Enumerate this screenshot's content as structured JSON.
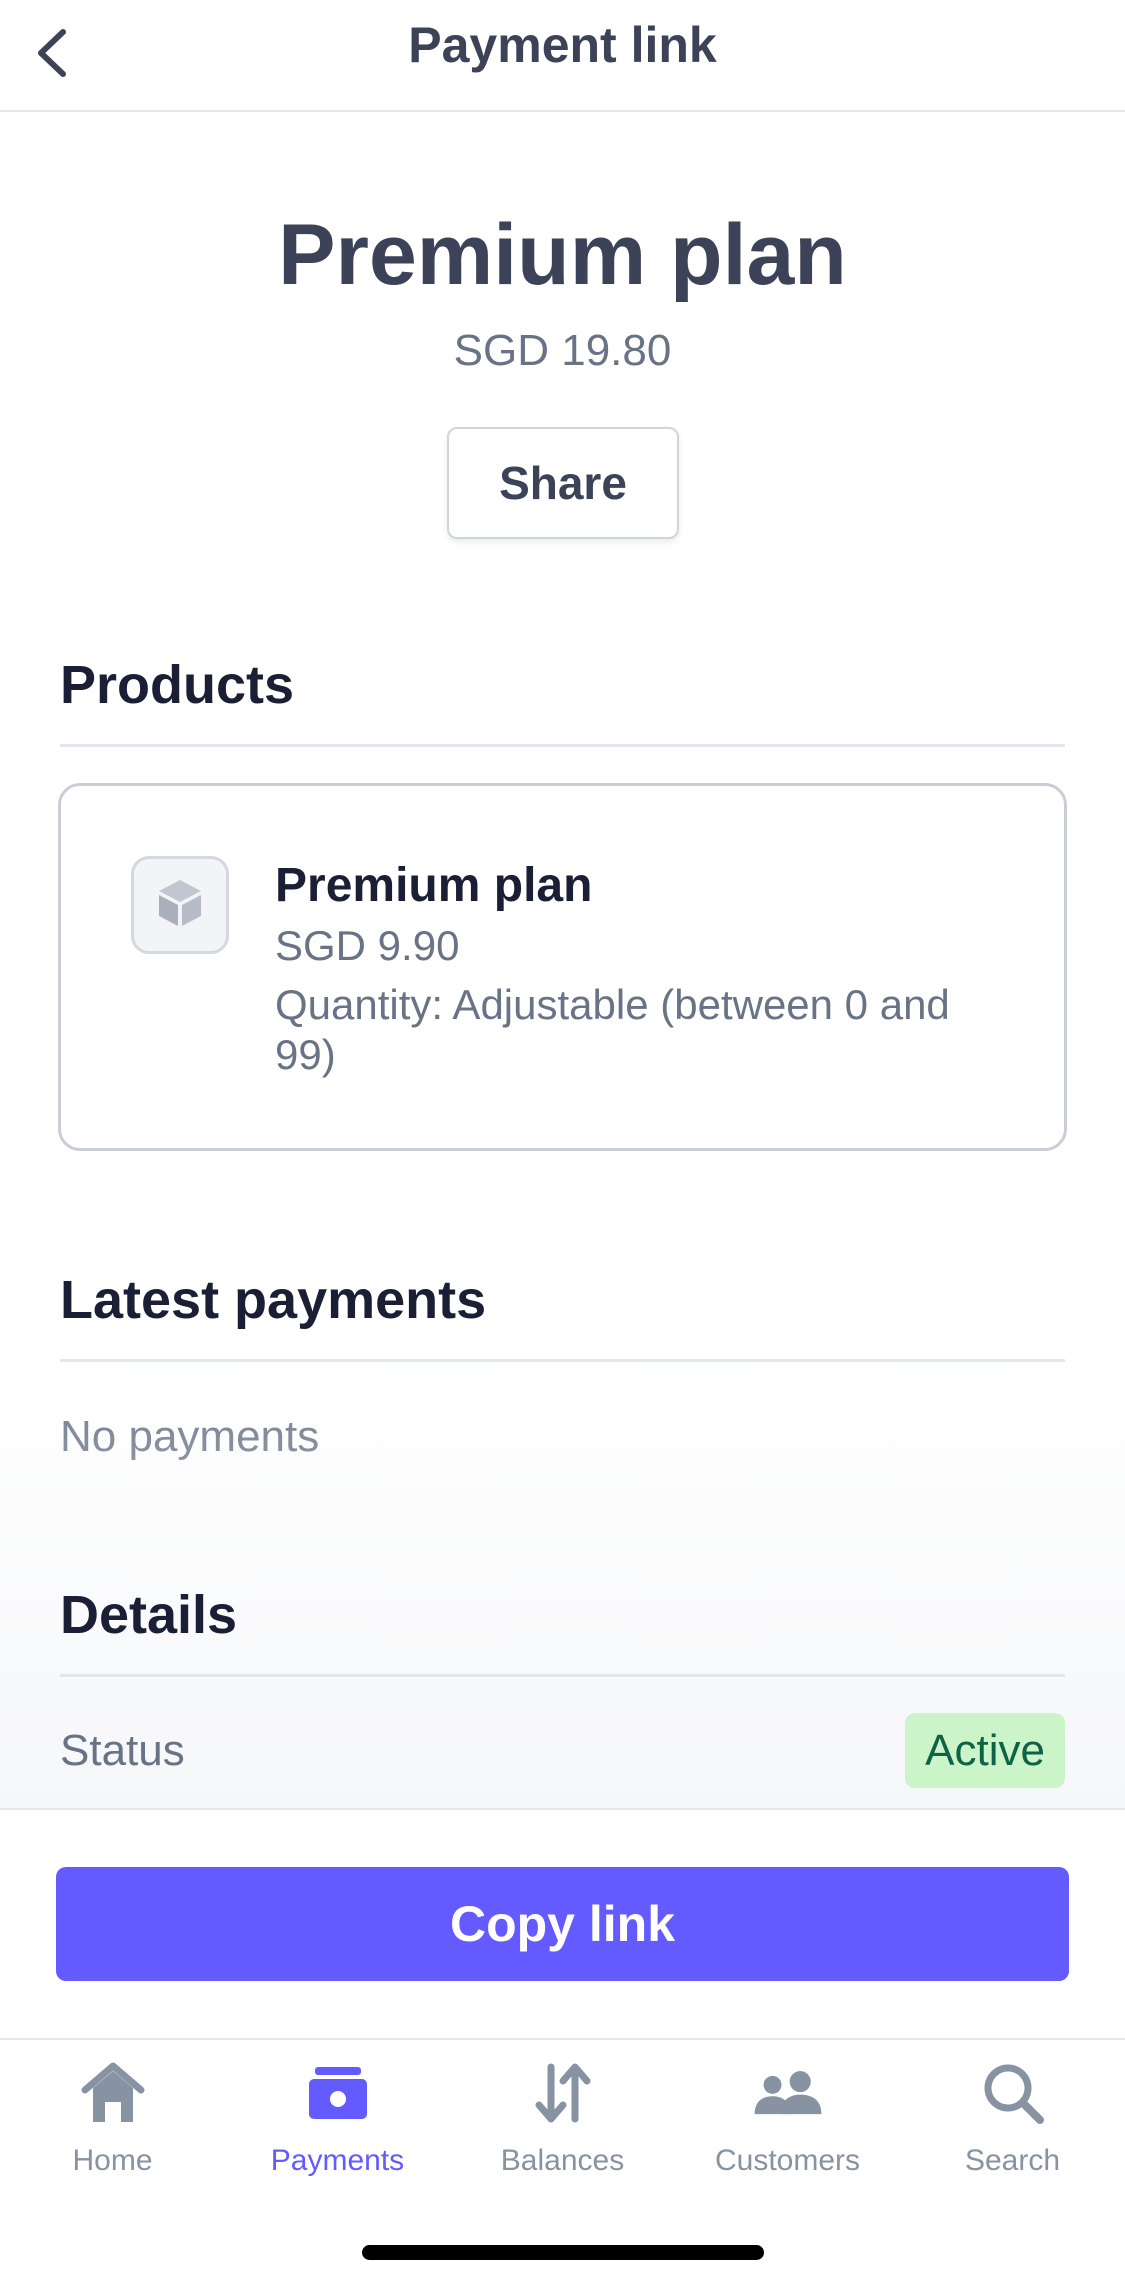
{
  "nav": {
    "title": "Payment link"
  },
  "hero": {
    "title": "Premium plan",
    "price": "SGD 19.80",
    "share_label": "Share"
  },
  "products": {
    "title": "Products",
    "items": [
      {
        "name": "Premium plan",
        "price": "SGD 9.90",
        "quantity": "Quantity: Adjustable (between 0 and 99)",
        "icon": "box-icon"
      }
    ]
  },
  "latest_payments": {
    "title": "Latest payments",
    "empty": "No payments"
  },
  "details": {
    "title": "Details",
    "status_label": "Status",
    "status_value": "Active"
  },
  "cta": {
    "copy_label": "Copy link"
  },
  "tabbar": {
    "active": "Payments",
    "tabs": [
      {
        "label": "Home",
        "icon": "house-icon"
      },
      {
        "label": "Payments",
        "icon": "wallet-icon"
      },
      {
        "label": "Balances",
        "icon": "transfer-arrows-icon"
      },
      {
        "label": "Customers",
        "icon": "people-icon"
      },
      {
        "label": "Search",
        "icon": "search-icon"
      }
    ]
  },
  "colors": {
    "accent": "#635bff",
    "heading": "#3c4257",
    "muted": "#697386",
    "success_bg": "#cbf4c9",
    "success_text": "#0e6245"
  }
}
